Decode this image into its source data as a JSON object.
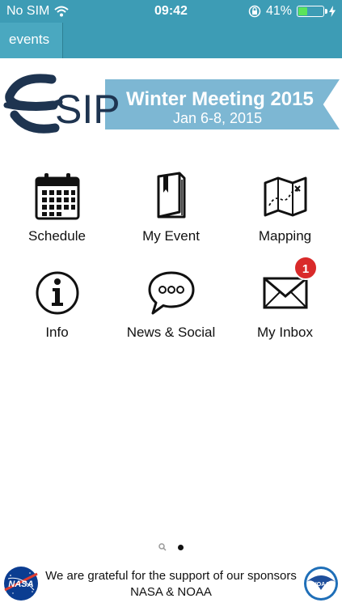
{
  "status_bar": {
    "carrier": "No SIM",
    "time": "09:42",
    "battery_percent": "41%",
    "battery_level": 0.41,
    "wifi_icon": "wifi-icon",
    "lock_icon": "orientation-lock-icon"
  },
  "nav": {
    "tab_label": "events"
  },
  "banner": {
    "logo_text": "SIP",
    "title": "Winter Meeting 2015",
    "date": "Jan 6-8, 2015"
  },
  "grid": [
    {
      "label": "Schedule",
      "icon": "calendar-icon"
    },
    {
      "label": "My Event",
      "icon": "book-icon"
    },
    {
      "label": "Mapping",
      "icon": "map-icon"
    },
    {
      "label": "Info",
      "icon": "info-icon"
    },
    {
      "label": "News & Social",
      "icon": "speech-bubble-icon"
    },
    {
      "label": "My Inbox",
      "icon": "envelope-icon",
      "badge": "1"
    }
  ],
  "page_indicator": {
    "pages": 2,
    "current": 2
  },
  "footer": {
    "line1": "We are grateful for the support of our sponsors",
    "line2": "NASA & NOAA",
    "nasa_logo_text": "NASA",
    "noaa_logo_text": "NOAA"
  },
  "colors": {
    "header_bg": "#3d9cb5",
    "ribbon": "#7db7d3",
    "logo_navy": "#1e3450",
    "badge_red": "#d92a2a"
  }
}
